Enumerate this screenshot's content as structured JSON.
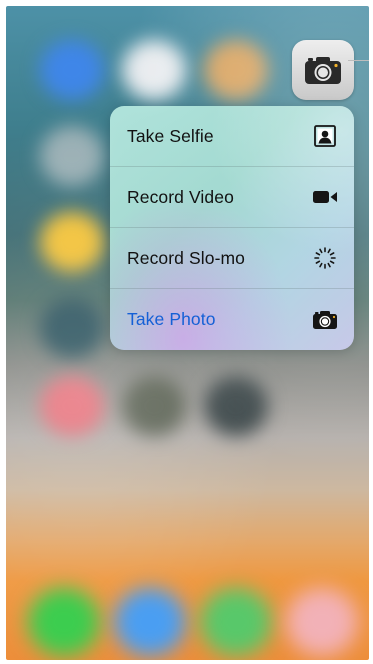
{
  "home_screen": {
    "app_icons": [
      {
        "name": "blurred-app-icon",
        "color": "#3f86e8"
      },
      {
        "name": "blurred-app-icon",
        "color": "#e9ecef"
      },
      {
        "name": "blurred-app-icon",
        "color": "#d9a35f"
      },
      {
        "name": "blurred-app-icon",
        "color": "#9bb0b5"
      },
      {
        "name": "blurred-app-icon",
        "color": "#f2c23a"
      },
      {
        "name": "blurred-app-icon",
        "color": "#2f5661"
      },
      {
        "name": "blurred-app-icon",
        "color": "#e8747e"
      },
      {
        "name": "blurred-app-icon",
        "color": "#5f6658"
      },
      {
        "name": "blurred-app-icon",
        "color": "#3f4a4c"
      }
    ],
    "dock_icons": [
      {
        "name": "dock-phone-icon",
        "color": "#3ccd4f"
      },
      {
        "name": "dock-safari-icon",
        "color": "#4a9ef2"
      },
      {
        "name": "dock-messages-icon",
        "color": "#58c86a"
      },
      {
        "name": "dock-music-icon",
        "color": "#f2b1b7"
      }
    ]
  },
  "camera_app": {
    "icon": "camera-icon",
    "background": "#e0e0e0"
  },
  "quick_actions": {
    "items": [
      {
        "label": "Take Selfie",
        "icon": "selfie-portrait-icon",
        "accent": false
      },
      {
        "label": "Record Video",
        "icon": "video-camera-icon",
        "accent": false
      },
      {
        "label": "Record Slo-mo",
        "icon": "slo-mo-icon",
        "accent": false
      },
      {
        "label": "Take Photo",
        "icon": "camera-icon",
        "accent": true
      }
    ],
    "accent_color": "#1560d6"
  }
}
